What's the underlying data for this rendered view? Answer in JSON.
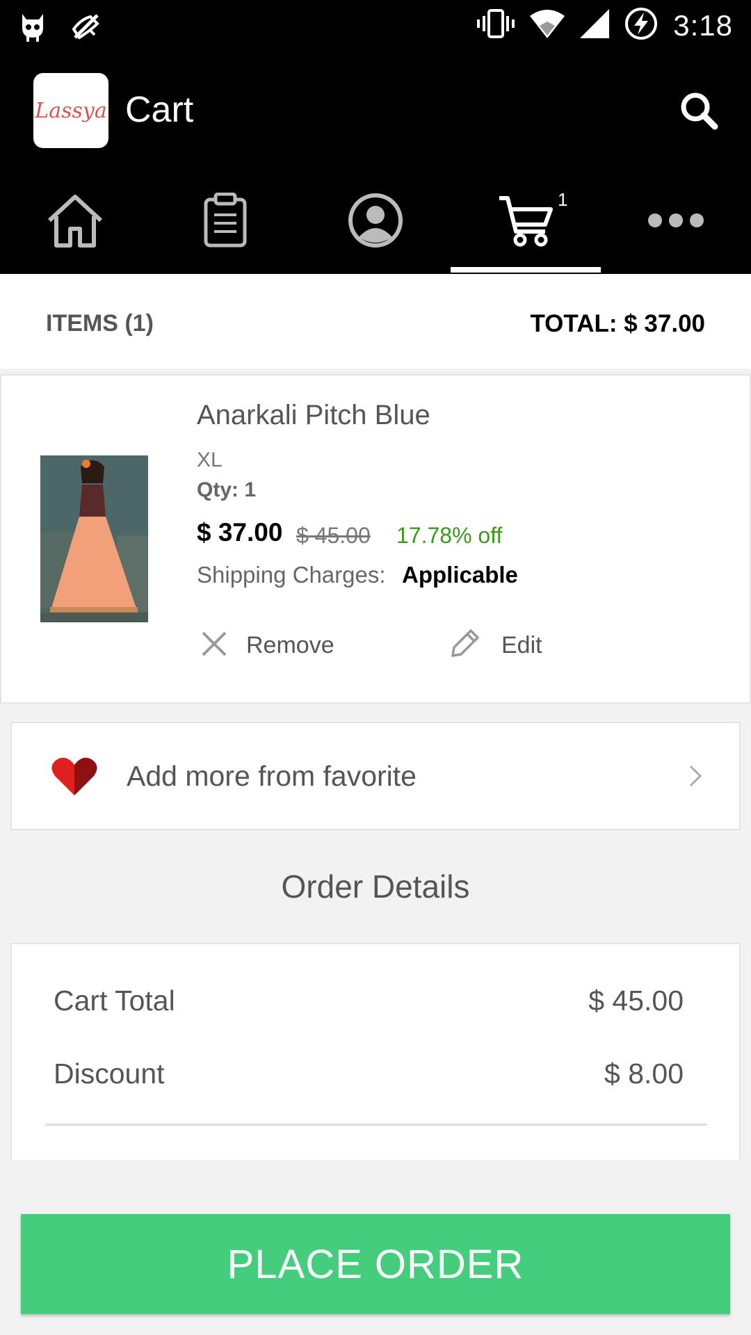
{
  "status_bar": {
    "time": "3:18",
    "icons": [
      "android-cat-icon",
      "notifications-muted-icon",
      "vibrate-icon",
      "wifi-icon",
      "signal-icon",
      "battery-charging-icon"
    ]
  },
  "app_bar": {
    "logo_text": "Lassya",
    "title": "Cart",
    "search_icon": "search-icon"
  },
  "nav": {
    "items": [
      {
        "name": "home",
        "icon": "home-icon"
      },
      {
        "name": "orders",
        "icon": "clipboard-icon"
      },
      {
        "name": "account",
        "icon": "user-icon"
      },
      {
        "name": "cart",
        "icon": "cart-icon",
        "active": true
      },
      {
        "name": "more",
        "icon": "more-icon"
      }
    ],
    "cart_badge": "1"
  },
  "summary": {
    "items_label": "ITEMS (1)",
    "total_label": "TOTAL: $ 37.00"
  },
  "cart_item": {
    "name": "Anarkali Pitch Blue",
    "size": "XL",
    "qty": "Qty: 1",
    "price": "$ 37.00",
    "original_price": "$ 45.00",
    "discount": "17.78% off",
    "shipping_label": "Shipping Charges:",
    "shipping_value": "Applicable",
    "remove_label": "Remove",
    "edit_label": "Edit"
  },
  "favorite": {
    "label": "Add more from favorite"
  },
  "order_details": {
    "title": "Order Details",
    "rows": [
      {
        "label": "Cart Total",
        "value": "$ 45.00"
      },
      {
        "label": "Discount",
        "value": "$ 8.00"
      }
    ]
  },
  "place_order": {
    "label": "PLACE ORDER"
  },
  "colors": {
    "accent_green": "#45cd7e",
    "discount_green": "#3a9a1a",
    "heart_red": "#cc1f1f"
  }
}
